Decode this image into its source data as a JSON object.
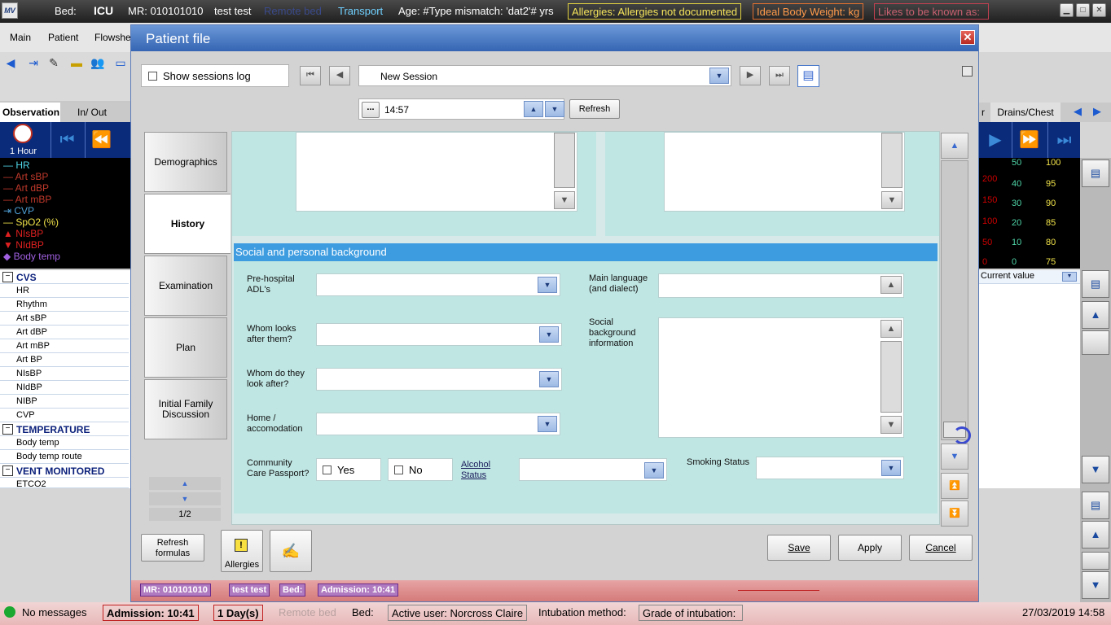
{
  "topbar": {
    "logo": "MV",
    "bed_label": "Bed:",
    "bed_value": "ICU",
    "mr": "MR: 010101010",
    "patient_name": "test test",
    "remote_bed": "Remote bed",
    "transport": "Transport",
    "age": "Age: #Type mismatch: 'dat2'# yrs",
    "allergies": "Allergies: Allergies not documented",
    "ibw": "Ideal Body Weight: kg",
    "likes": "Likes to be known as:"
  },
  "app_menu": [
    "Main",
    "Patient",
    "Flowshee"
  ],
  "left_tabs": [
    "Observation",
    "In/ Out"
  ],
  "time_interval": "1 Hour",
  "legend": [
    {
      "label": "HR",
      "color": "#4fd6e8"
    },
    {
      "label": "Art sBP",
      "color": "#c0392b"
    },
    {
      "label": "Art dBP",
      "color": "#c0392b"
    },
    {
      "label": "Art mBP",
      "color": "#c0392b"
    },
    {
      "label": "CVP",
      "color": "#4fa0d6"
    },
    {
      "label": "SpO2 (%)",
      "color": "#f1e34a"
    },
    {
      "label": "NIsBP",
      "color": "#e02020"
    },
    {
      "label": "NIdBP",
      "color": "#e02020"
    },
    {
      "label": "Body temp",
      "color": "#a060e0"
    }
  ],
  "rows": [
    {
      "label": "CVS",
      "group": true
    },
    {
      "label": "HR"
    },
    {
      "label": "Rhythm"
    },
    {
      "label": "Art sBP"
    },
    {
      "label": "Art dBP"
    },
    {
      "label": "Art mBP"
    },
    {
      "label": "Art BP"
    },
    {
      "label": "NIsBP"
    },
    {
      "label": "NIdBP"
    },
    {
      "label": "NIBP"
    },
    {
      "label": "CVP"
    },
    {
      "label": "TEMPERATURE",
      "group": true
    },
    {
      "label": "Body temp"
    },
    {
      "label": "Body temp route"
    },
    {
      "label": "VENT MONITORED",
      "group": true
    },
    {
      "label": "ETCO2"
    }
  ],
  "right_tabs": [
    "r",
    "Drains/Chest"
  ],
  "right_scale": {
    "col1": [
      "200",
      "150",
      "100",
      "50",
      "0"
    ],
    "col2": [
      "50",
      "40",
      "30",
      "20",
      "10",
      "0"
    ],
    "col3": [
      "100",
      "95",
      "90",
      "85",
      "80",
      "75"
    ]
  },
  "current_value": "Current value",
  "dialog": {
    "title": "Patient file",
    "show_sessions_log": "Show sessions log",
    "session": "New Session",
    "time": "14:57",
    "ellipsis": "...",
    "refresh": "Refresh",
    "tabs": [
      "Demographics",
      "History",
      "Examination",
      "Plan",
      "Initial Family Discussion"
    ],
    "page_indicator": "1/2",
    "section_title": "Social  and personal background",
    "fields": {
      "preadl": "Pre-hospital ADL's",
      "whom_looks": "Whom looks after them?",
      "whom_do": "Whom do they look after?",
      "home": "Home / accomodation",
      "ccp": "Community Care Passport?",
      "yes": "Yes",
      "no": "No",
      "alcohol": "Alcohol Status",
      "main_lang": "Main language (and dialect)",
      "social_bg": "Social background information",
      "smoking": "Smoking Status"
    },
    "buttons": {
      "refresh_formulas": "Refresh formulas",
      "allergies": "Allergies",
      "save": "Save",
      "apply": "Apply",
      "cancel": "Cancel"
    },
    "footer": {
      "mr": "MR: 010101010",
      "name": "test test",
      "bed": "Bed:",
      "admission": "Admission: 10:41"
    }
  },
  "statusbar": {
    "messages": "No messages",
    "admission": "Admission: 10:41",
    "days": "1 Day(s)",
    "remote_bed": "Remote bed",
    "bed": "Bed:",
    "active_user": "Active user: Norcross Claire",
    "intubation": "Intubation method:",
    "grade": "Grade of intubation:",
    "datetime": "27/03/2019 14:58"
  }
}
